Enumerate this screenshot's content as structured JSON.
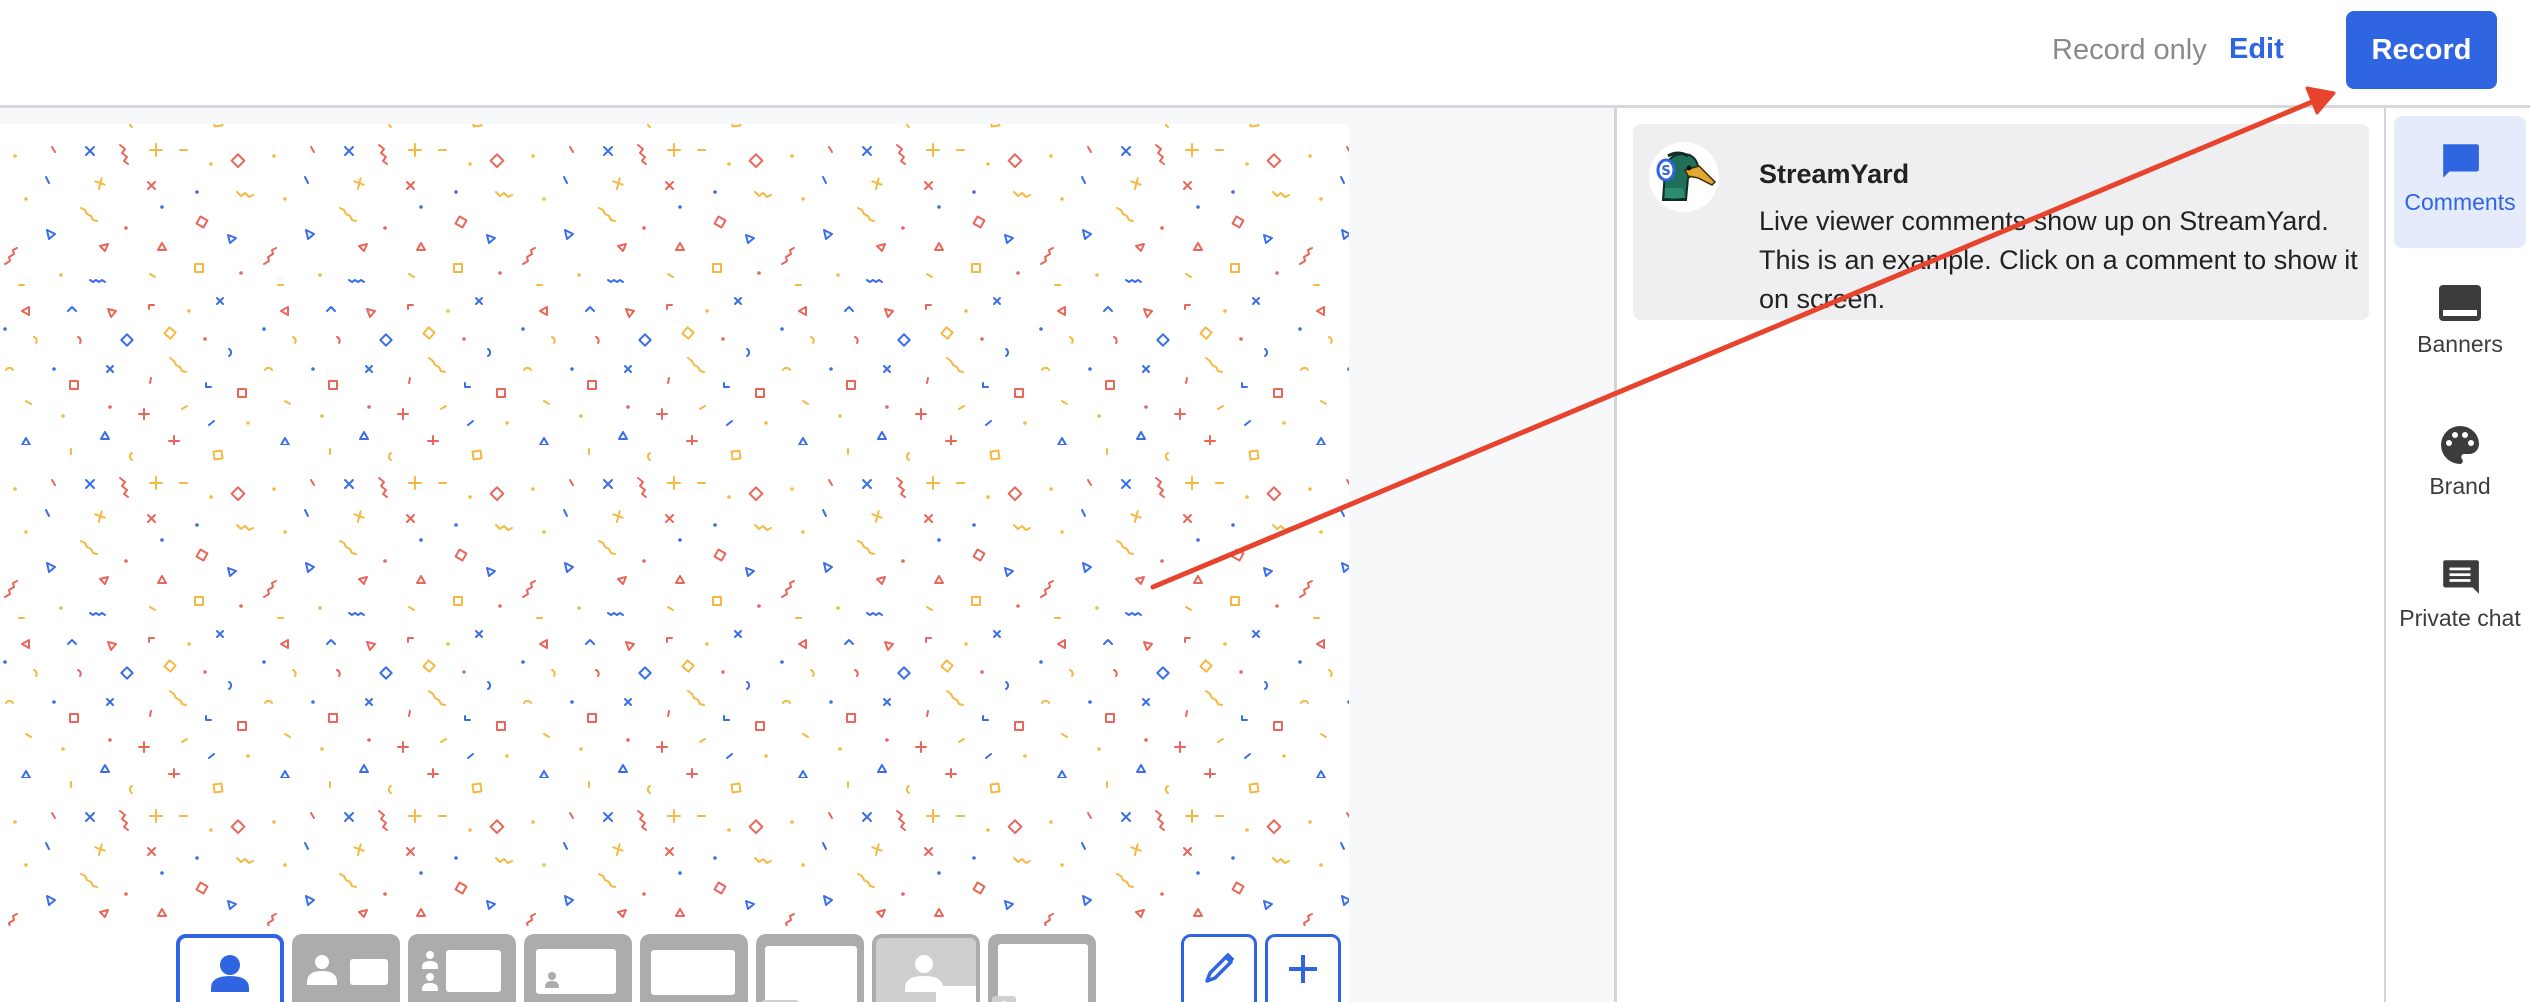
{
  "header": {
    "record_only_label": "Record only",
    "edit_label": "Edit",
    "record_button_label": "Record"
  },
  "stage": {
    "background": "confetti",
    "confetti_colors": [
      "#e8665a",
      "#f5b942",
      "#3a6ee8"
    ]
  },
  "layouts": [
    {
      "name": "solo",
      "active": true
    },
    {
      "name": "person-and-screen",
      "active": false
    },
    {
      "name": "two-people-and-screen",
      "active": false
    },
    {
      "name": "screen-with-small-person",
      "active": false
    },
    {
      "name": "screen-only",
      "active": false
    },
    {
      "name": "screen-with-group",
      "active": false
    },
    {
      "name": "person-with-screen-overlay",
      "active": false
    },
    {
      "name": "screen-with-corner-person",
      "active": false
    }
  ],
  "stage_tools": {
    "edit_icon": "pencil-icon",
    "add_icon": "plus-icon"
  },
  "comments": [
    {
      "author": "StreamYard",
      "avatar": "duck-avatar",
      "text": "Live viewer comments show up on StreamYard. This is an example. Click on a comment to show it on screen."
    }
  ],
  "sidebar": {
    "items": [
      {
        "label": "Comments",
        "icon": "comment-icon",
        "active": true
      },
      {
        "label": "Banners",
        "icon": "banner-icon",
        "active": false
      },
      {
        "label": "Brand",
        "icon": "palette-icon",
        "active": false
      },
      {
        "label": "Private chat",
        "icon": "chat-icon",
        "active": false
      }
    ]
  },
  "colors": {
    "accent": "#2f65e0",
    "annotation_arrow": "#e8432c",
    "sidebar_active_bg": "#e5ebfb",
    "comment_card_bg": "#efeff1"
  }
}
